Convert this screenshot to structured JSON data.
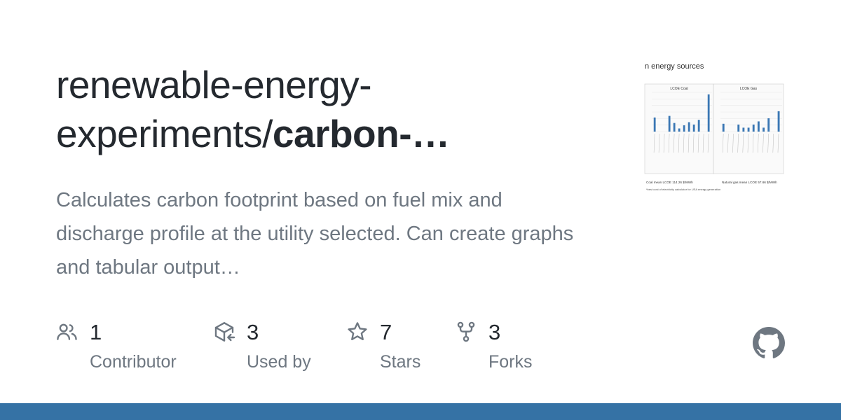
{
  "repo": {
    "owner_path": "renewable-energy-experiments/",
    "name_visible": "carbon-…",
    "description": "Calculates carbon footprint based on fuel mix and discharge profile at the utility selected. Can create graphs and tabular output…"
  },
  "stats": [
    {
      "value": "1",
      "label": "Contributor",
      "icon": "people-icon"
    },
    {
      "value": "3",
      "label": "Used by",
      "icon": "package-dependents-icon"
    },
    {
      "value": "7",
      "label": "Stars",
      "icon": "star-icon"
    },
    {
      "value": "3",
      "label": "Forks",
      "icon": "repo-forked-icon"
    }
  ],
  "preview": {
    "heading": "n energy sources",
    "panel_left_title": "LCOE Coal",
    "panel_right_title": "LCOE Gas",
    "caption_left": "Coal mean LCOE 114.26 $/MWh",
    "caption_right": "Natural gas mean LCOE 57.66 $/MWh",
    "footnote": "*best cost of electricity calculator for USA energy generation",
    "bar_values_left": [
      36,
      0,
      0,
      40,
      22,
      8,
      16,
      24,
      18,
      30,
      0,
      95
    ],
    "bar_values_right": [
      20,
      0,
      0,
      18,
      10,
      10,
      18,
      26,
      10,
      34,
      0,
      52
    ]
  },
  "colors": {
    "accent_bar": "#3572a5",
    "title": "#24292f",
    "muted": "#6e7781",
    "chart_bar": "#3a77b4"
  }
}
